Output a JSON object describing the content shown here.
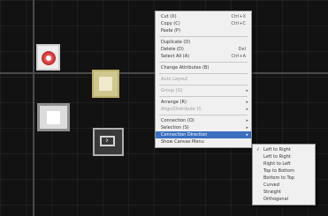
{
  "context_menu": {
    "items": [
      {
        "label": "Cut (X)",
        "shortcut": "Ctrl+X"
      },
      {
        "label": "Copy (C)",
        "shortcut": "Ctrl+C"
      },
      {
        "label": "Paste (P)"
      },
      {
        "sep": true
      },
      {
        "label": "Duplicate (D)"
      },
      {
        "label": "Delete (D)",
        "shortcut": "Del"
      },
      {
        "label": "Select All (A)",
        "shortcut": "Ctrl+A"
      },
      {
        "sep": true
      },
      {
        "label": "Change Attributes (B)"
      },
      {
        "sep": true
      },
      {
        "label": "Auto Layout",
        "disabled": true
      },
      {
        "sep": true
      },
      {
        "label": "Group (G)",
        "disabled": true,
        "submenu": true
      },
      {
        "sep": true
      },
      {
        "label": "Arrange (R)",
        "submenu": true
      },
      {
        "label": "Align/Distribute (I)",
        "disabled": true,
        "submenu": true
      },
      {
        "sep": true
      },
      {
        "label": "Connection (O)",
        "submenu": true
      },
      {
        "label": "Selection (S)",
        "submenu": true
      },
      {
        "label": "Connection Direction",
        "submenu": true,
        "highlighted": true
      },
      {
        "label": "Show Canvas Menu"
      }
    ]
  },
  "submenu": {
    "items": [
      {
        "label": "Left to Right",
        "checked": true
      },
      {
        "label": "Left to Right"
      },
      {
        "label": "Right to Left"
      },
      {
        "label": "Top to Bottom"
      },
      {
        "label": "Bottom to Top"
      },
      {
        "label": "Curved"
      },
      {
        "label": "Straight"
      },
      {
        "label": "Orthogonal"
      }
    ]
  },
  "icons": {
    "check": "check-icon",
    "submenu_arrow": "chevron-right-icon"
  },
  "colors": {
    "canvas_bg": "#121212",
    "menu_bg": "#f0f0f0",
    "highlight": "#3a6fbf"
  }
}
